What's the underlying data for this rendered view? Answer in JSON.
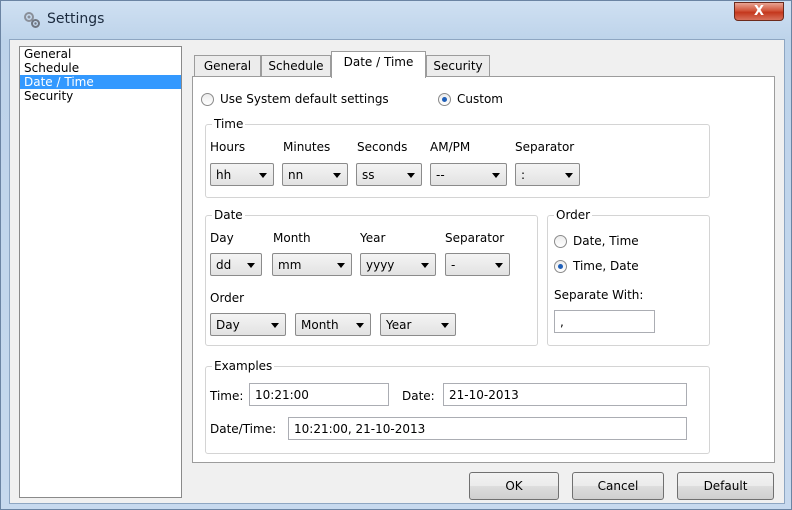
{
  "window": {
    "title": "Settings",
    "close_label": "X"
  },
  "nav": {
    "items": [
      "General",
      "Schedule",
      "Date / Time",
      "Security"
    ],
    "selected_index": 2
  },
  "tabs": [
    "General",
    "Schedule",
    "Date / Time",
    "Security"
  ],
  "active_tab": "Date / Time",
  "mode": {
    "system_default_label": "Use System default settings",
    "custom_label": "Custom",
    "selected": "custom"
  },
  "time_group": {
    "title": "Time",
    "fields": [
      {
        "label": "Hours",
        "value": "hh"
      },
      {
        "label": "Minutes",
        "value": "nn"
      },
      {
        "label": "Seconds",
        "value": "ss"
      },
      {
        "label": "AM/PM",
        "value": "--"
      },
      {
        "label": "Separator",
        "value": ":"
      }
    ]
  },
  "date_group": {
    "title": "Date",
    "fields": [
      {
        "label": "Day",
        "value": "dd"
      },
      {
        "label": "Month",
        "value": "mm"
      },
      {
        "label": "Year",
        "value": "yyyy"
      },
      {
        "label": "Separator",
        "value": "-"
      }
    ],
    "order_label": "Order",
    "order_values": [
      "Day",
      "Month",
      "Year"
    ]
  },
  "order_group": {
    "title": "Order",
    "option_date_time": "Date, Time",
    "option_time_date": "Time, Date",
    "selected": "time_date",
    "separate_with_label": "Separate With:",
    "separate_with_value": ","
  },
  "examples": {
    "title": "Examples",
    "time_label": "Time:",
    "time_value": "10:21:00",
    "date_label": "Date:",
    "date_value": "21-10-2013",
    "datetime_label": "Date/Time:",
    "datetime_value": "10:21:00, 21-10-2013"
  },
  "buttons": {
    "ok": "OK",
    "cancel": "Cancel",
    "default": "Default"
  },
  "icons": {
    "title": "gears-icon",
    "close": "close-icon",
    "combo": "chevron-down-icon"
  }
}
